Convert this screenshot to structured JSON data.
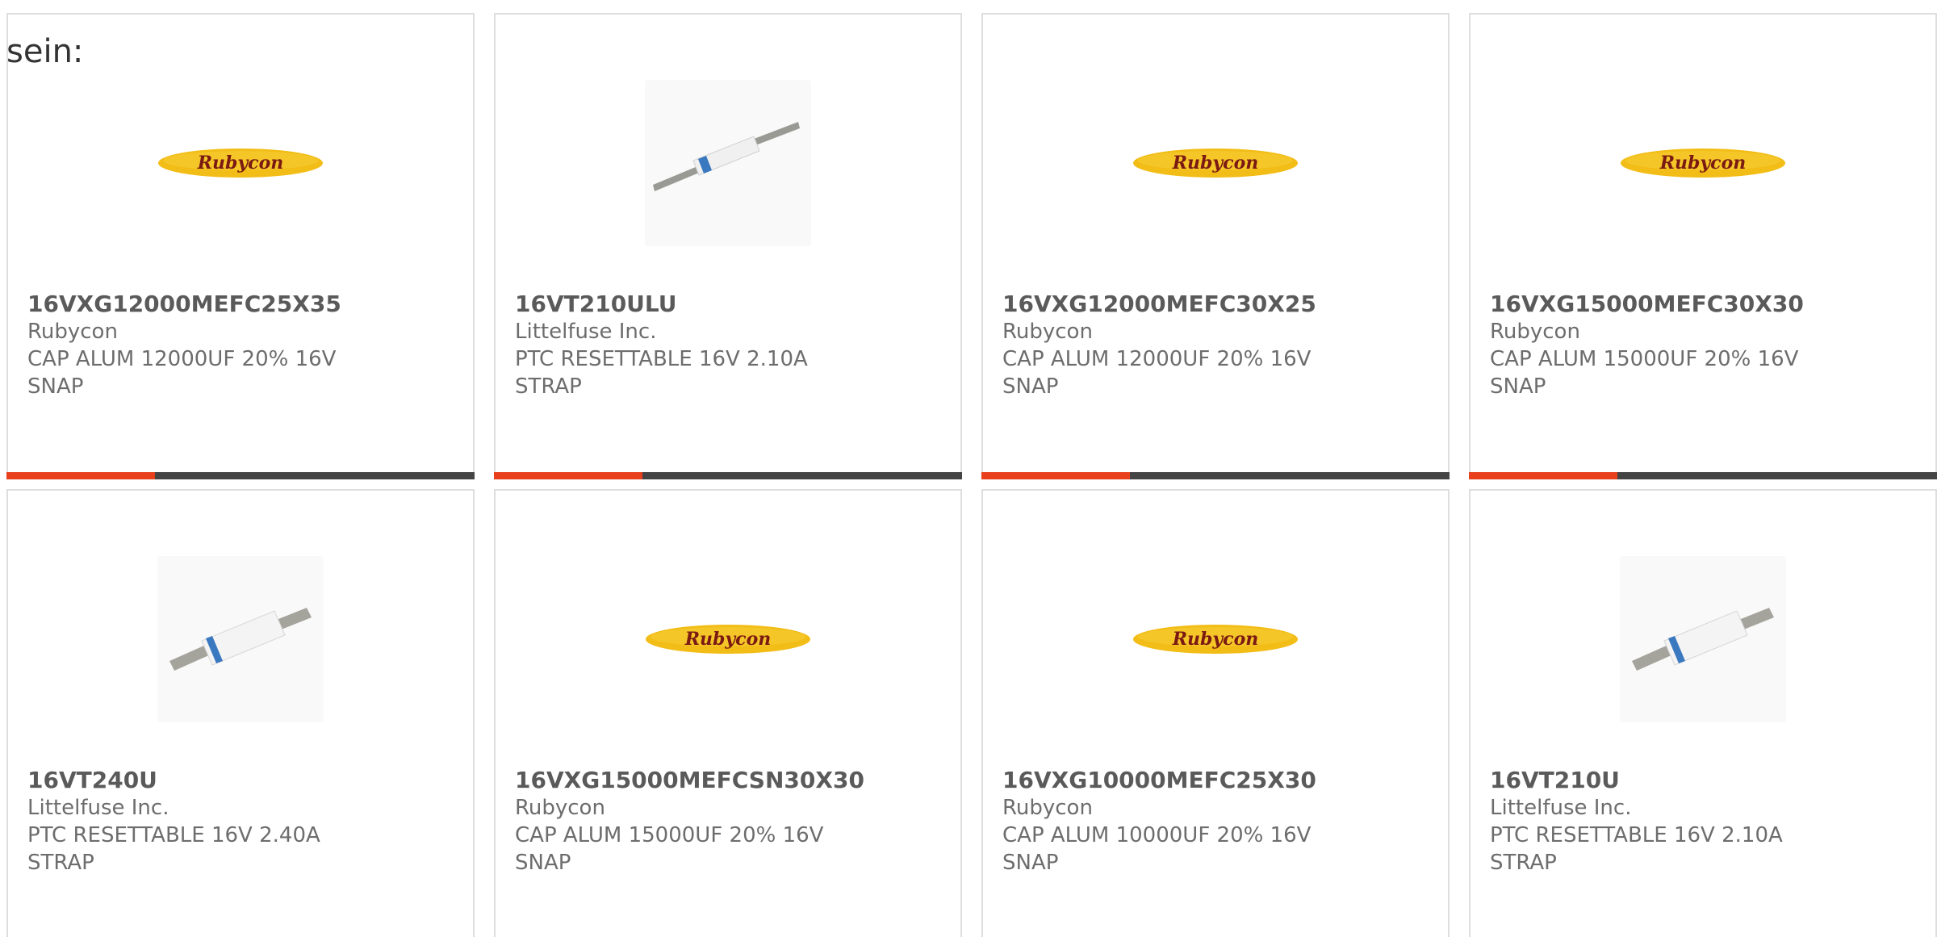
{
  "intro_text": "sein:",
  "colors": {
    "accent": "#e8401c",
    "bar": "#444444",
    "logo_yellow": "#f2bd16",
    "logo_text": "#7a1a12"
  },
  "products": [
    {
      "part": "16VXG12000MEFC25X35",
      "manufacturer": "Rubycon",
      "desc": "CAP ALUM 12000UF 20% 16V SNAP",
      "image": "rubycon-logo",
      "logo_text": "Rubycon"
    },
    {
      "part": "16VT210ULU",
      "manufacturer": "Littelfuse Inc.",
      "desc": "PTC RESETTABLE 16V 2.10A STRAP",
      "image": "strap-fuse-long",
      "logo_text": ""
    },
    {
      "part": "16VXG12000MEFC30X25",
      "manufacturer": "Rubycon",
      "desc": "CAP ALUM 12000UF 20% 16V SNAP",
      "image": "rubycon-logo",
      "logo_text": "Rubycon"
    },
    {
      "part": "16VXG15000MEFC30X30",
      "manufacturer": "Rubycon",
      "desc": "CAP ALUM 15000UF 20% 16V SNAP",
      "image": "rubycon-logo",
      "logo_text": "Rubycon"
    },
    {
      "part": "16VT240U",
      "manufacturer": "Littelfuse Inc.",
      "desc": "PTC RESETTABLE 16V 2.40A STRAP",
      "image": "strap-fuse-short",
      "logo_text": ""
    },
    {
      "part": "16VXG15000MEFCSN30X30",
      "manufacturer": "Rubycon",
      "desc": "CAP ALUM 15000UF 20% 16V SNAP",
      "image": "rubycon-logo",
      "logo_text": "Rubycon"
    },
    {
      "part": "16VXG10000MEFC25X30",
      "manufacturer": "Rubycon",
      "desc": "CAP ALUM 10000UF 20% 16V SNAP",
      "image": "rubycon-logo",
      "logo_text": "Rubycon"
    },
    {
      "part": "16VT210U",
      "manufacturer": "Littelfuse Inc.",
      "desc": "PTC RESETTABLE 16V 2.10A STRAP",
      "image": "strap-fuse-short",
      "logo_text": ""
    }
  ]
}
